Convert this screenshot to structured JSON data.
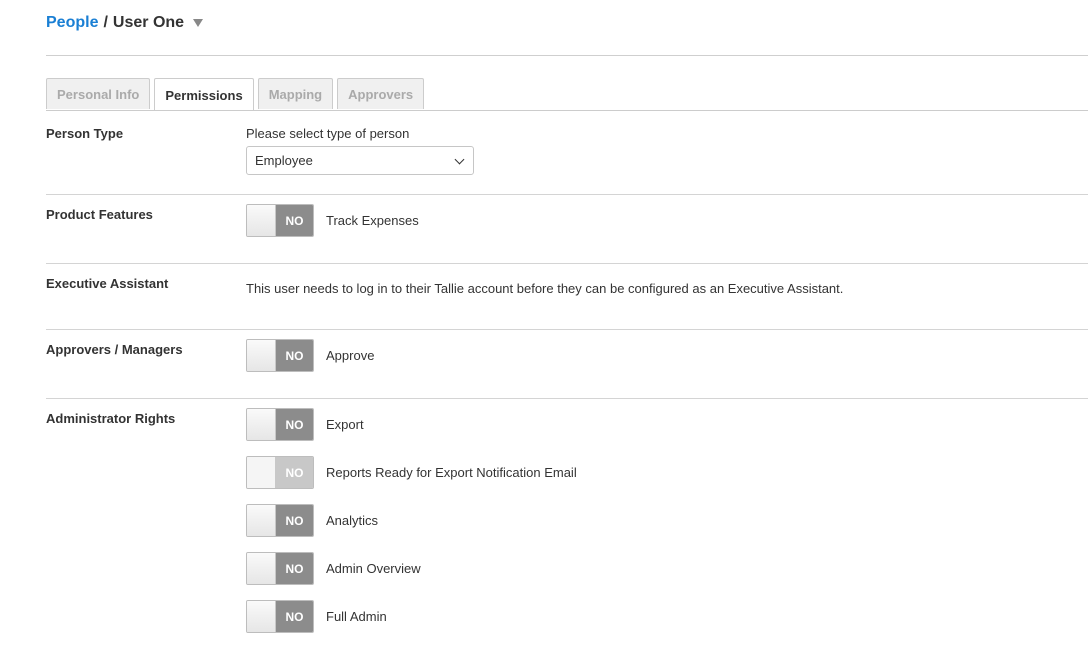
{
  "breadcrumb": {
    "root": "People",
    "separator": "/",
    "current": "User One"
  },
  "tabs": [
    {
      "label": "Personal Info",
      "active": false
    },
    {
      "label": "Permissions",
      "active": true
    },
    {
      "label": "Mapping",
      "active": false
    },
    {
      "label": "Approvers",
      "active": false
    }
  ],
  "person_type": {
    "label": "Person Type",
    "select_label": "Please select type of person",
    "selected": "Employee"
  },
  "product_features": {
    "label": "Product Features",
    "toggles": [
      {
        "state": "NO",
        "text": "Track Expenses",
        "disabled": false
      }
    ]
  },
  "executive_assistant": {
    "label": "Executive Assistant",
    "message": "This user needs to log in to their Tallie account before they can be configured as an Executive Assistant."
  },
  "approvers_managers": {
    "label": "Approvers / Managers",
    "toggles": [
      {
        "state": "NO",
        "text": "Approve",
        "disabled": false
      }
    ]
  },
  "administrator_rights": {
    "label": "Administrator Rights",
    "toggles": [
      {
        "state": "NO",
        "text": "Export",
        "disabled": false
      },
      {
        "state": "NO",
        "text": "Reports Ready for Export Notification Email",
        "disabled": true
      },
      {
        "state": "NO",
        "text": "Analytics",
        "disabled": false
      },
      {
        "state": "NO",
        "text": "Admin Overview",
        "disabled": false
      },
      {
        "state": "NO",
        "text": "Full Admin",
        "disabled": false
      }
    ]
  }
}
